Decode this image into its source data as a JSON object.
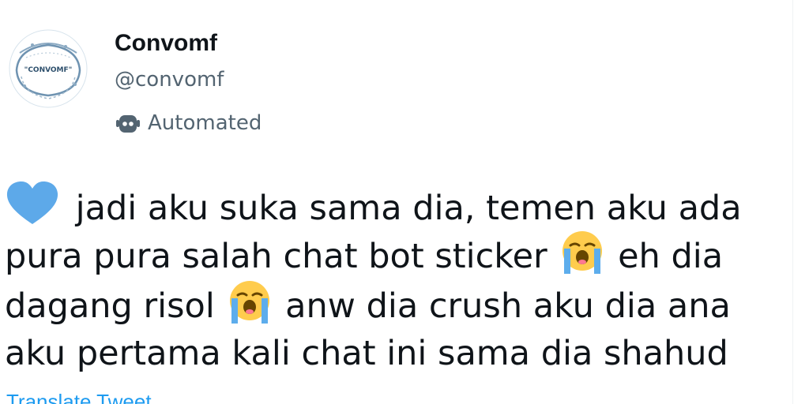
{
  "profile": {
    "display_name": "Convomf",
    "handle": "@convomf",
    "automated_label": "Automated",
    "avatar_text": "\"CONVOMF\""
  },
  "tweet": {
    "lines": [
      {
        "pre_emoji": "heart-emoji",
        "text": "jadi aku suka sama dia, temen aku ada"
      },
      {
        "text_a": "pura pura salah chat bot sticker",
        "emoji": "loudly-crying-face",
        "text_b": "eh dia"
      },
      {
        "text_a": "dagang risol",
        "emoji": "loudly-crying-face",
        "text_b": "anw dia crush aku dia ana"
      },
      {
        "text": "aku pertama kali chat ini sama dia shahud"
      }
    ],
    "translate_label": "Translate Tweet"
  },
  "colors": {
    "text_primary": "#0f1419",
    "text_secondary": "#536471",
    "link": "#1d9bf0",
    "heart": "#5da9e9",
    "emoji_face": "#ffcc4d",
    "emoji_tears": "#5dadec"
  },
  "icons": [
    "robot-icon",
    "blue-heart-emoji",
    "loudly-crying-face-emoji"
  ]
}
